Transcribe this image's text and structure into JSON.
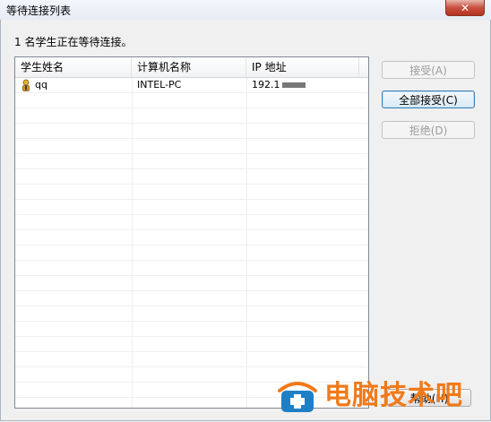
{
  "window": {
    "title": "等待连接列表",
    "close_label": "✕"
  },
  "status_text": "1 名学生正在等待连接。",
  "list": {
    "columns": [
      "学生姓名",
      "计算机名称",
      "IP 地址"
    ],
    "rows": [
      {
        "student_name": "qq",
        "icon": "student-user-icon",
        "computer_name": "INTEL-PC",
        "ip_visible": "192.1"
      }
    ]
  },
  "buttons": {
    "accept": "接受(A)",
    "accept_all": "全部接受(C)",
    "reject": "拒绝(D)",
    "help": "帮助(H)"
  },
  "watermark": {
    "text": "电脑技术吧",
    "color": "#f07a1a"
  }
}
